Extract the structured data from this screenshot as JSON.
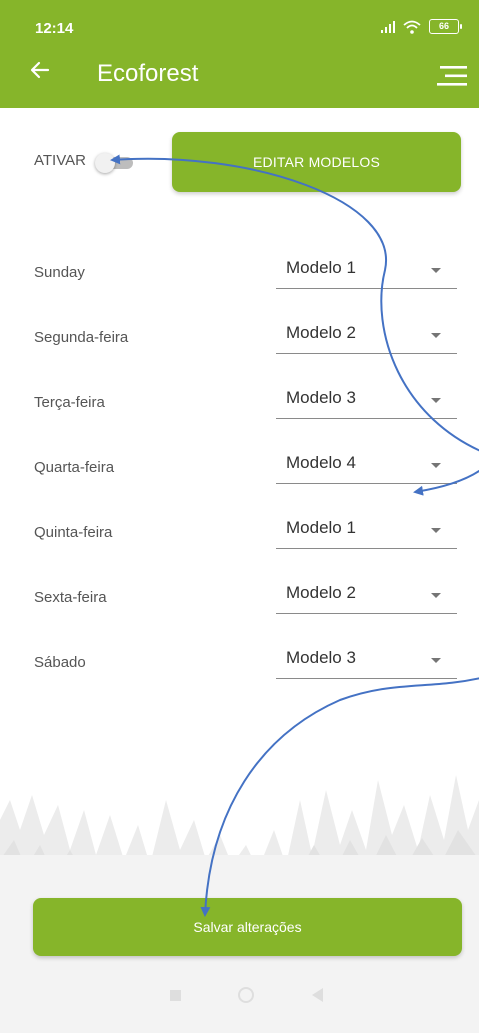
{
  "status_bar": {
    "time": "12:14",
    "battery": "66"
  },
  "header": {
    "title": "Ecoforest"
  },
  "controls": {
    "activate_label": "ATIVAR",
    "edit_button": "EDITAR MODELOS"
  },
  "schedule": [
    {
      "day": "Sunday",
      "model": "Modelo 1"
    },
    {
      "day": "Segunda-feira",
      "model": "Modelo 2"
    },
    {
      "day": "Terça-feira",
      "model": "Modelo 3"
    },
    {
      "day": "Quarta-feira",
      "model": "Modelo 4"
    },
    {
      "day": "Quinta-feira",
      "model": "Modelo 1"
    },
    {
      "day": "Sexta-feira",
      "model": "Modelo 2"
    },
    {
      "day": "Sábado",
      "model": "Modelo 3"
    }
  ],
  "footer": {
    "save_button": "Salvar alterações"
  },
  "colors": {
    "brand": "#86b52a",
    "annotation_arrow": "#4472c4"
  },
  "icons": [
    "arrow-left-icon",
    "menu-icon",
    "signal-icon",
    "wifi-icon",
    "battery-icon",
    "chevron-down-icon"
  ]
}
